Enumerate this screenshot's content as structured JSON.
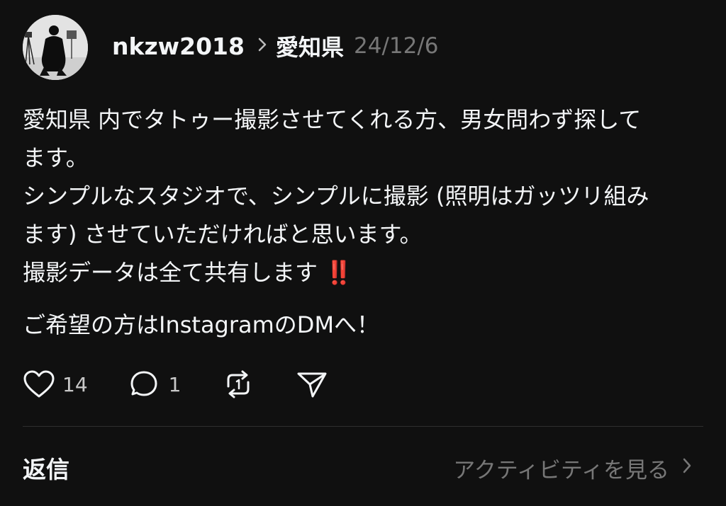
{
  "post": {
    "username": "nkzw2018",
    "location": "愛知県",
    "date": "24/12/6",
    "lines": [
      "愛知県 内でタトゥー撮影させてくれる方、男女問わず探して",
      "ます。",
      "シンプルなスタジオで、シンプルに撮影 (照明はガッツリ組み",
      "ます) させていただければと思います。",
      "撮影データは全て共有します"
    ],
    "emphasis": "‼️",
    "cta": "ご希望の方はInstagramのDMへ！"
  },
  "actions": {
    "like_icon": "heart-icon",
    "like_count": "14",
    "comment_icon": "comment-icon",
    "comment_count": "1",
    "repost_icon": "repost-icon",
    "share_icon": "send-icon"
  },
  "footer": {
    "replies_label": "返信",
    "activity_label": "アクティビティを見る",
    "activity_icon": "chevron-right-icon"
  },
  "colors": {
    "background": "#101010",
    "text": "#f3f5f7",
    "muted": "#777777",
    "emphasis": "#e8231f"
  }
}
